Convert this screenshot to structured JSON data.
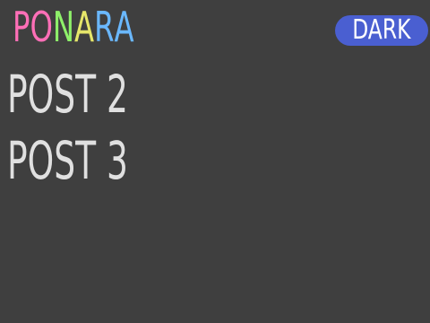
{
  "header": {
    "logo_letters": [
      {
        "char": "P",
        "color": "#ff6fb7"
      },
      {
        "char": "O",
        "color": "#ff6fb7"
      },
      {
        "char": "N",
        "color": "#8ef06a"
      },
      {
        "char": "A",
        "color": "#e6e66a"
      },
      {
        "char": "R",
        "color": "#6ab8ff"
      },
      {
        "char": "A",
        "color": "#6ab8ff"
      }
    ],
    "theme_toggle_label": "DARK",
    "theme_toggle_color": "#4a5fd1"
  },
  "posts": [
    {
      "title": "POST 2"
    },
    {
      "title": "POST 3"
    }
  ]
}
